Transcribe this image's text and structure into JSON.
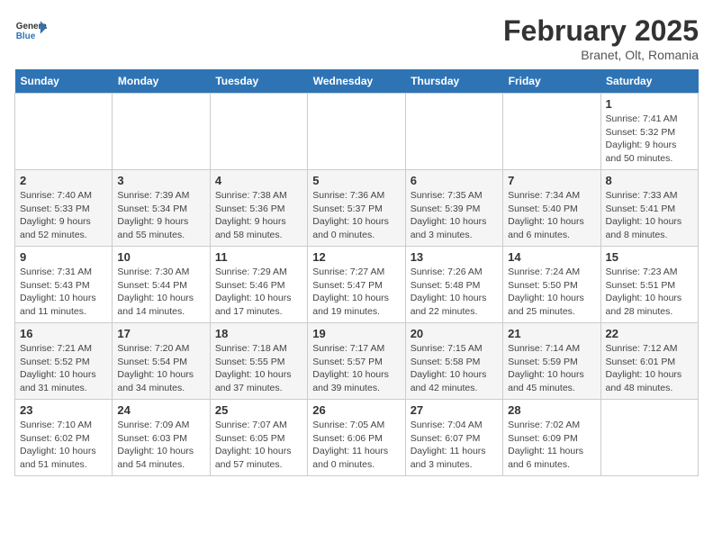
{
  "header": {
    "logo_general": "General",
    "logo_blue": "Blue",
    "month": "February 2025",
    "location": "Branet, Olt, Romania"
  },
  "days_of_week": [
    "Sunday",
    "Monday",
    "Tuesday",
    "Wednesday",
    "Thursday",
    "Friday",
    "Saturday"
  ],
  "weeks": [
    [
      {
        "day": "",
        "info": ""
      },
      {
        "day": "",
        "info": ""
      },
      {
        "day": "",
        "info": ""
      },
      {
        "day": "",
        "info": ""
      },
      {
        "day": "",
        "info": ""
      },
      {
        "day": "",
        "info": ""
      },
      {
        "day": "1",
        "info": "Sunrise: 7:41 AM\nSunset: 5:32 PM\nDaylight: 9 hours and 50 minutes."
      }
    ],
    [
      {
        "day": "2",
        "info": "Sunrise: 7:40 AM\nSunset: 5:33 PM\nDaylight: 9 hours and 52 minutes."
      },
      {
        "day": "3",
        "info": "Sunrise: 7:39 AM\nSunset: 5:34 PM\nDaylight: 9 hours and 55 minutes."
      },
      {
        "day": "4",
        "info": "Sunrise: 7:38 AM\nSunset: 5:36 PM\nDaylight: 9 hours and 58 minutes."
      },
      {
        "day": "5",
        "info": "Sunrise: 7:36 AM\nSunset: 5:37 PM\nDaylight: 10 hours and 0 minutes."
      },
      {
        "day": "6",
        "info": "Sunrise: 7:35 AM\nSunset: 5:39 PM\nDaylight: 10 hours and 3 minutes."
      },
      {
        "day": "7",
        "info": "Sunrise: 7:34 AM\nSunset: 5:40 PM\nDaylight: 10 hours and 6 minutes."
      },
      {
        "day": "8",
        "info": "Sunrise: 7:33 AM\nSunset: 5:41 PM\nDaylight: 10 hours and 8 minutes."
      }
    ],
    [
      {
        "day": "9",
        "info": "Sunrise: 7:31 AM\nSunset: 5:43 PM\nDaylight: 10 hours and 11 minutes."
      },
      {
        "day": "10",
        "info": "Sunrise: 7:30 AM\nSunset: 5:44 PM\nDaylight: 10 hours and 14 minutes."
      },
      {
        "day": "11",
        "info": "Sunrise: 7:29 AM\nSunset: 5:46 PM\nDaylight: 10 hours and 17 minutes."
      },
      {
        "day": "12",
        "info": "Sunrise: 7:27 AM\nSunset: 5:47 PM\nDaylight: 10 hours and 19 minutes."
      },
      {
        "day": "13",
        "info": "Sunrise: 7:26 AM\nSunset: 5:48 PM\nDaylight: 10 hours and 22 minutes."
      },
      {
        "day": "14",
        "info": "Sunrise: 7:24 AM\nSunset: 5:50 PM\nDaylight: 10 hours and 25 minutes."
      },
      {
        "day": "15",
        "info": "Sunrise: 7:23 AM\nSunset: 5:51 PM\nDaylight: 10 hours and 28 minutes."
      }
    ],
    [
      {
        "day": "16",
        "info": "Sunrise: 7:21 AM\nSunset: 5:52 PM\nDaylight: 10 hours and 31 minutes."
      },
      {
        "day": "17",
        "info": "Sunrise: 7:20 AM\nSunset: 5:54 PM\nDaylight: 10 hours and 34 minutes."
      },
      {
        "day": "18",
        "info": "Sunrise: 7:18 AM\nSunset: 5:55 PM\nDaylight: 10 hours and 37 minutes."
      },
      {
        "day": "19",
        "info": "Sunrise: 7:17 AM\nSunset: 5:57 PM\nDaylight: 10 hours and 39 minutes."
      },
      {
        "day": "20",
        "info": "Sunrise: 7:15 AM\nSunset: 5:58 PM\nDaylight: 10 hours and 42 minutes."
      },
      {
        "day": "21",
        "info": "Sunrise: 7:14 AM\nSunset: 5:59 PM\nDaylight: 10 hours and 45 minutes."
      },
      {
        "day": "22",
        "info": "Sunrise: 7:12 AM\nSunset: 6:01 PM\nDaylight: 10 hours and 48 minutes."
      }
    ],
    [
      {
        "day": "23",
        "info": "Sunrise: 7:10 AM\nSunset: 6:02 PM\nDaylight: 10 hours and 51 minutes."
      },
      {
        "day": "24",
        "info": "Sunrise: 7:09 AM\nSunset: 6:03 PM\nDaylight: 10 hours and 54 minutes."
      },
      {
        "day": "25",
        "info": "Sunrise: 7:07 AM\nSunset: 6:05 PM\nDaylight: 10 hours and 57 minutes."
      },
      {
        "day": "26",
        "info": "Sunrise: 7:05 AM\nSunset: 6:06 PM\nDaylight: 11 hours and 0 minutes."
      },
      {
        "day": "27",
        "info": "Sunrise: 7:04 AM\nSunset: 6:07 PM\nDaylight: 11 hours and 3 minutes."
      },
      {
        "day": "28",
        "info": "Sunrise: 7:02 AM\nSunset: 6:09 PM\nDaylight: 11 hours and 6 minutes."
      },
      {
        "day": "",
        "info": ""
      }
    ]
  ]
}
